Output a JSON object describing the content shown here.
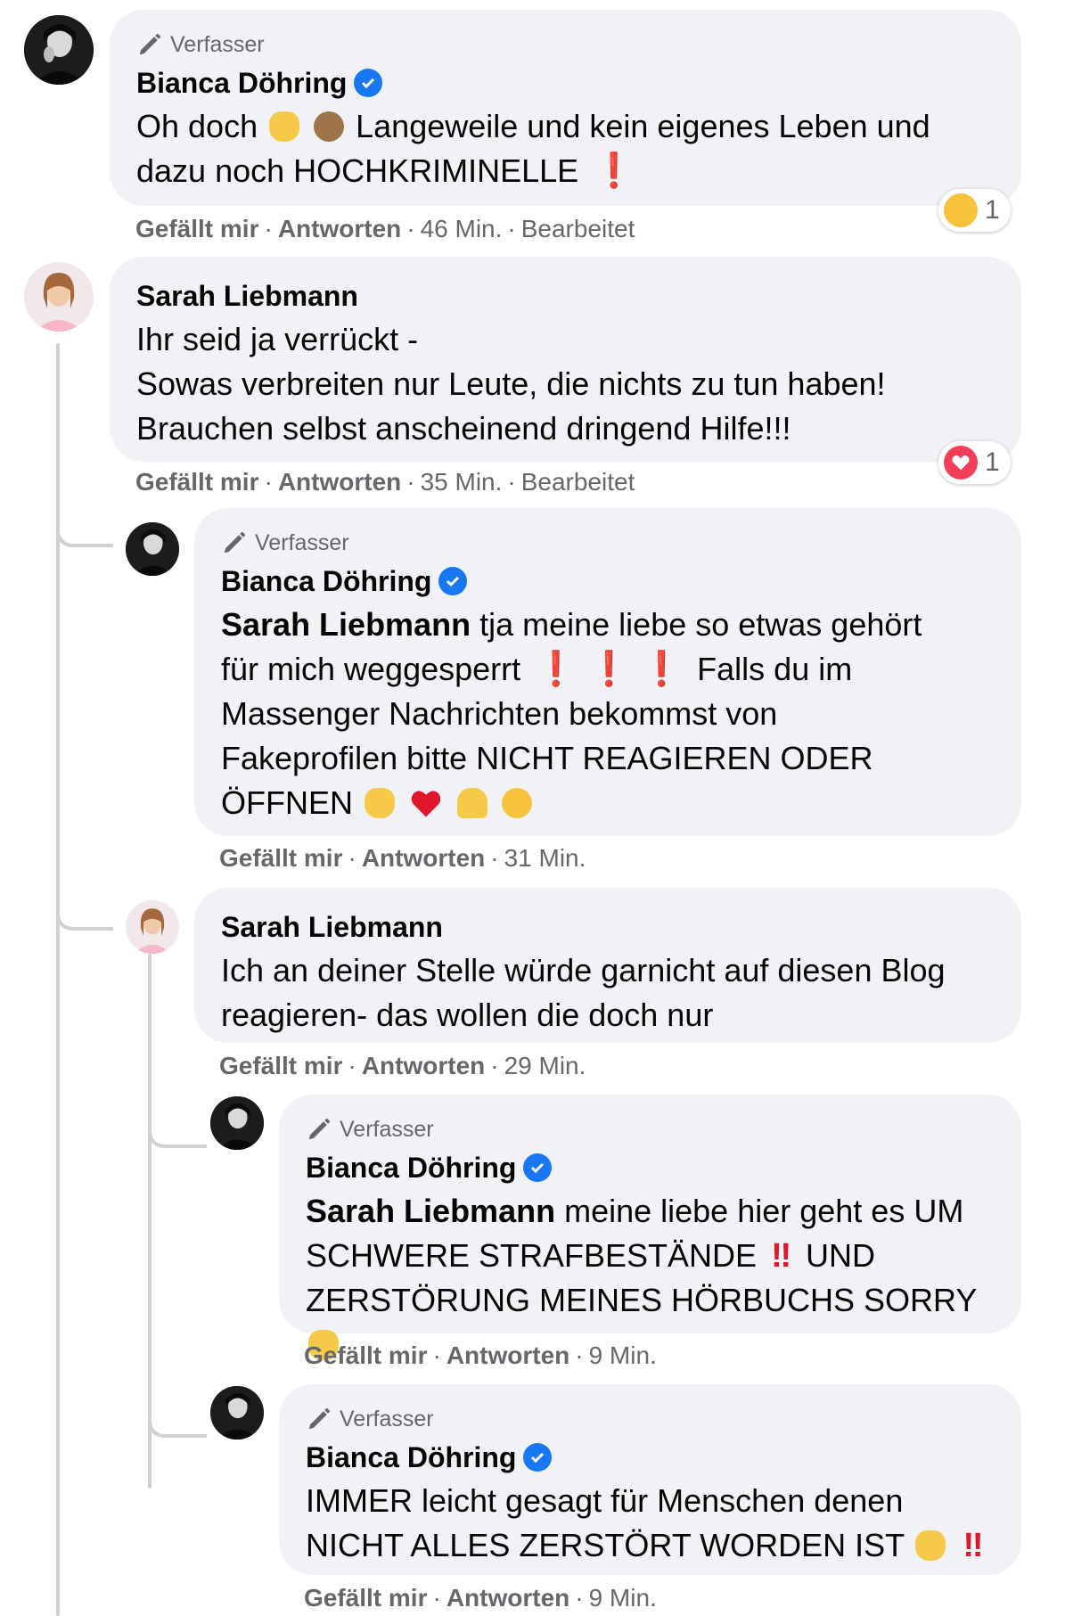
{
  "comments": [
    {
      "author_tag": "Verfasser",
      "author": "Bianca Döhring",
      "verified": true,
      "text_lines": [
        "Oh doch",
        "Langeweile und kein eigenes Leben und",
        "dazu noch HOCHKRIMINELLE"
      ],
      "like": "Gefällt mir",
      "reply": "Antworten",
      "time": "46 Min.",
      "edited": "Bearbeitet",
      "reaction_count": "1",
      "reaction_icon": "hug-emoji-icon"
    },
    {
      "author": "Sarah Liebmann",
      "text_lines": [
        "Ihr seid ja verrückt -",
        "Sowas verbreiten nur Leute, die nichts zu tun haben!",
        "Brauchen selbst anscheinend dringend Hilfe!!!"
      ],
      "like": "Gefällt mir",
      "reply": "Antworten",
      "time": "35 Min.",
      "edited": "Bearbeitet",
      "reaction_count": "1",
      "reaction_icon": "love-heart-icon"
    },
    {
      "author_tag": "Verfasser",
      "author": "Bianca Döhring",
      "verified": true,
      "mention": "Sarah Liebmann",
      "text_lines": [
        "tja meine liebe so etwas gehört",
        "für mich weggesperrt",
        "Falls du im",
        "Massenger Nachrichten bekommst von",
        "Fakeprofilen bitte NICHT REAGIEREN ODER",
        "ÖFFNEN"
      ],
      "like": "Gefällt mir",
      "reply": "Antworten",
      "time": "31 Min."
    },
    {
      "author": "Sarah Liebmann",
      "text_lines": [
        "Ich an deiner Stelle würde garnicht auf diesen Blog",
        "reagieren- das wollen die doch nur"
      ],
      "like": "Gefällt mir",
      "reply": "Antworten",
      "time": "29 Min."
    },
    {
      "author_tag": "Verfasser",
      "author": "Bianca Döhring",
      "verified": true,
      "mention": "Sarah Liebmann",
      "text_lines": [
        "meine liebe hier geht es UM",
        "SCHWERE STRAFBESTÄNDE",
        "UND",
        "ZERSTÖRUNG MEINES HÖRBUCHS SORRY"
      ],
      "like": "Gefällt mir",
      "reply": "Antworten",
      "time": "9 Min."
    },
    {
      "author_tag": "Verfasser",
      "author": "Bianca Döhring",
      "verified": true,
      "text_lines": [
        "IMMER leicht gesagt für Menschen denen",
        "NICHT ALLES ZERSTÖRT WORDEN IST"
      ],
      "like": "Gefällt mir",
      "reply": "Antworten",
      "time": "9 Min."
    }
  ],
  "colors": {
    "bubble": "#f0f2f5",
    "meta": "#65676b",
    "verified": "#1877f2",
    "exclamation": "#e0162b",
    "thread_line": "#ced0d4"
  }
}
